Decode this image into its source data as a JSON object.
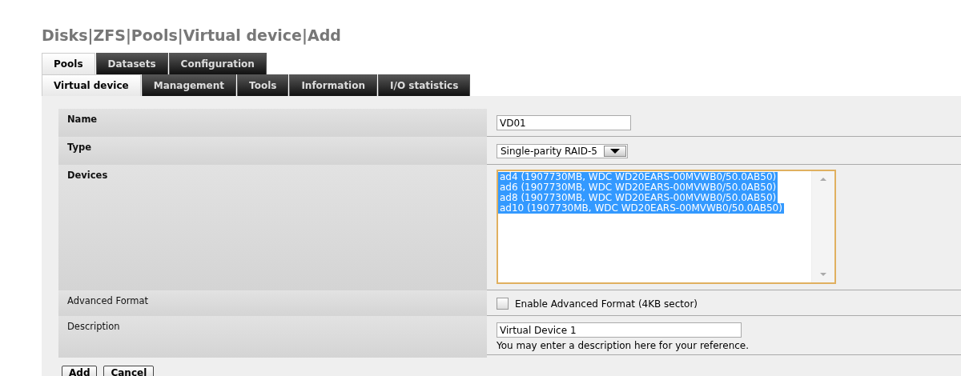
{
  "title": "Disks|ZFS|Pools|Virtual device|Add",
  "tabs": [
    {
      "label": "Pools",
      "selected": true
    },
    {
      "label": "Datasets",
      "selected": false
    },
    {
      "label": "Configuration",
      "selected": false
    }
  ],
  "subtabs": [
    {
      "label": "Virtual device",
      "selected": true
    },
    {
      "label": "Management",
      "selected": false
    },
    {
      "label": "Tools",
      "selected": false
    },
    {
      "label": "Information",
      "selected": false
    },
    {
      "label": "I/O statistics",
      "selected": false
    }
  ],
  "form": [
    {
      "kind": "text",
      "label": "Name",
      "required": true,
      "value": "VD01"
    },
    {
      "kind": "select",
      "label": "Type",
      "required": true,
      "value": "Single-parity RAID-5"
    },
    {
      "kind": "multiselect",
      "label": "Devices",
      "required": true,
      "options": [
        {
          "label": "ad4 (1907730MB, WDC WD20EARS-00MVWB0/50.0AB50)",
          "selected": true
        },
        {
          "label": "ad6 (1907730MB, WDC WD20EARS-00MVWB0/50.0AB50)",
          "selected": true
        },
        {
          "label": "ad8 (1907730MB, WDC WD20EARS-00MVWB0/50.0AB50)",
          "selected": true
        },
        {
          "label": "ad10 (1907730MB, WDC WD20EARS-00MVWB0/50.0AB50)",
          "selected": true
        }
      ]
    },
    {
      "kind": "checkbox",
      "label": "Advanced Format",
      "required": false,
      "checked": false,
      "text": "Enable Advanced Format (4KB sector)"
    },
    {
      "kind": "text",
      "label": "Description",
      "required": false,
      "value": "Virtual Device 1",
      "hint": "You may enter a description here for your reference."
    }
  ],
  "buttons": [
    "Add",
    "Cancel"
  ]
}
